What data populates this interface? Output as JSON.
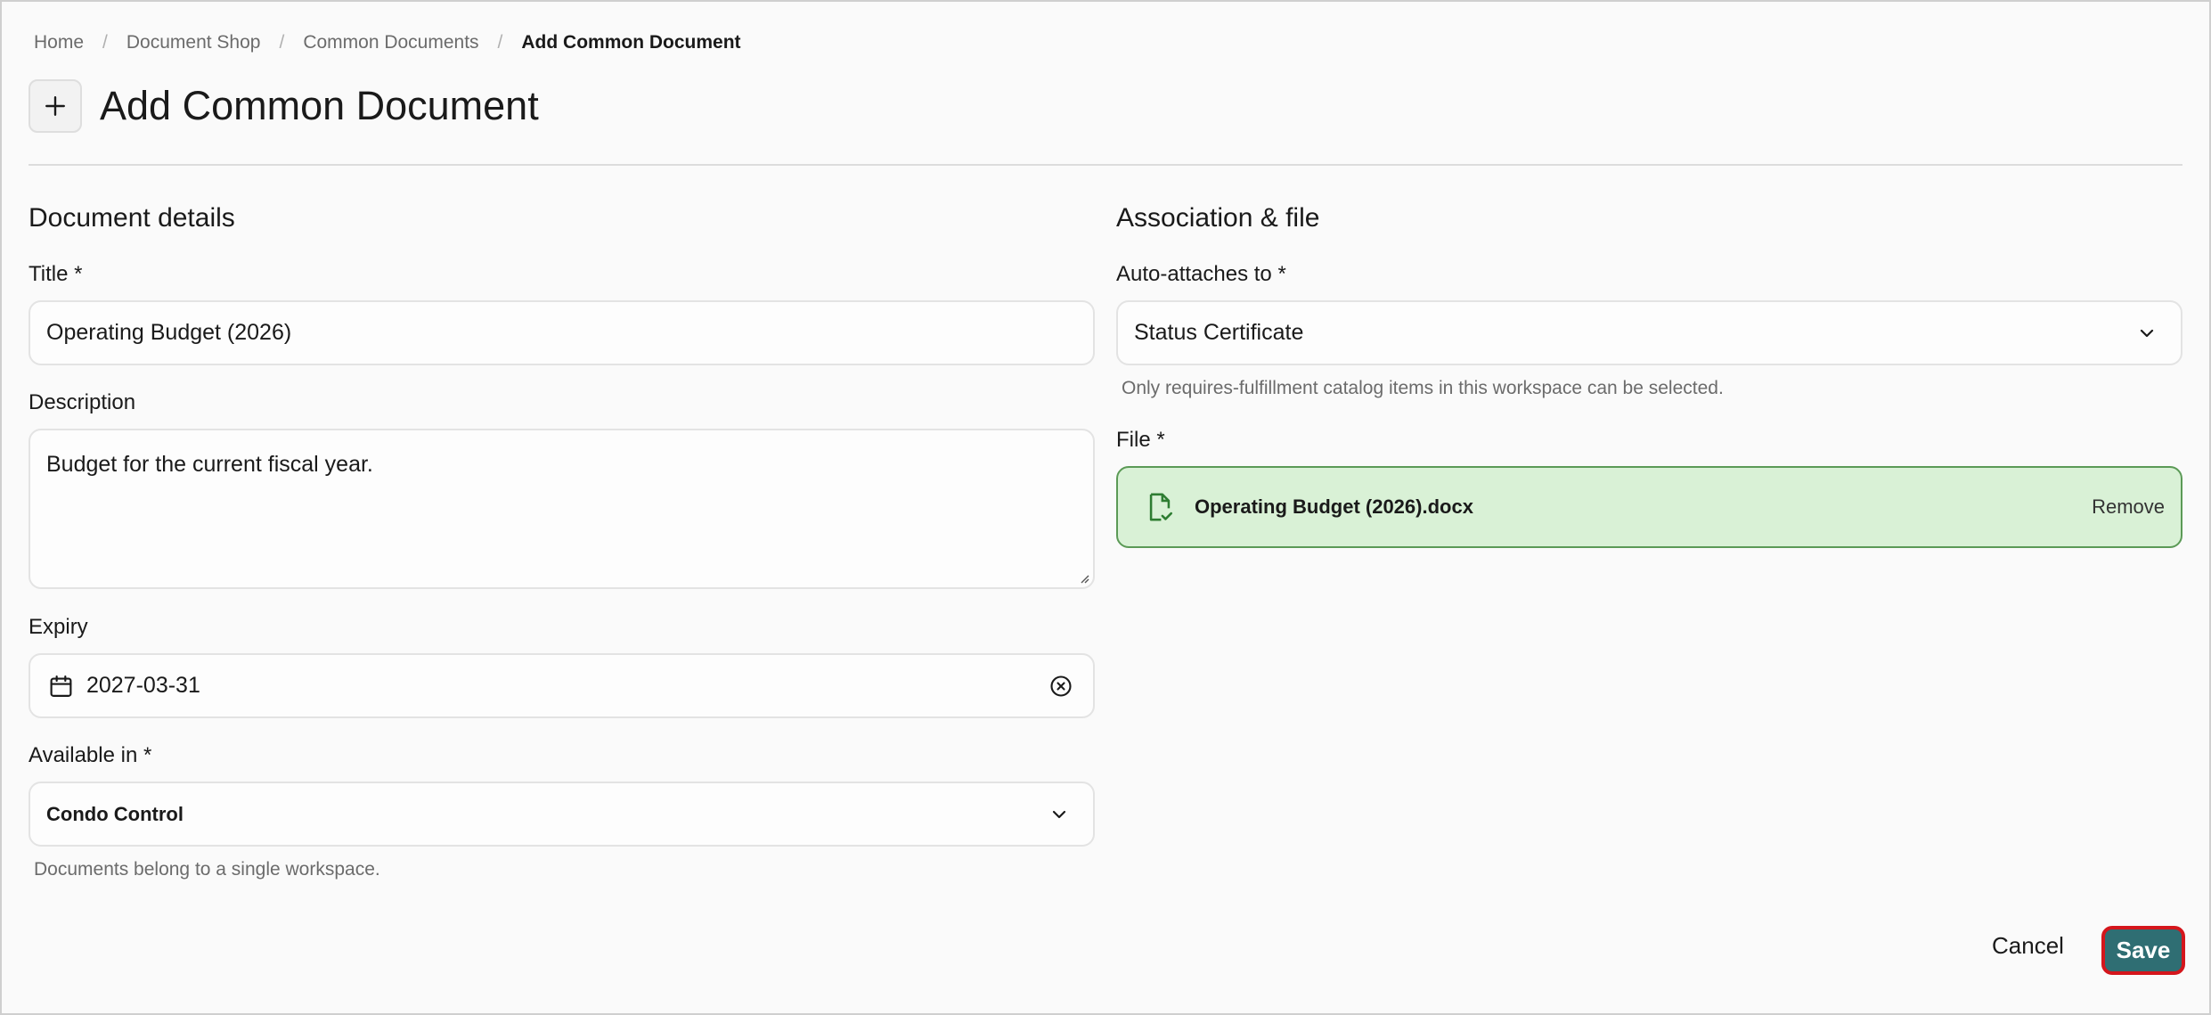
{
  "breadcrumb": {
    "items": [
      "Home",
      "Document Shop",
      "Common Documents"
    ],
    "separator": "/",
    "current": "Add Common Document"
  },
  "header": {
    "title": "Add Common Document",
    "icon": "plus-icon"
  },
  "left": {
    "section_title": "Document details",
    "title_label": "Title *",
    "title_value": "Operating Budget (2026)",
    "description_label": "Description",
    "description_value": "Budget for the current fiscal year.",
    "expiry_label": "Expiry",
    "expiry_value": "2027-03-31",
    "available_label": "Available in *",
    "available_value": "Condo Control",
    "available_helper": "Documents belong to a single workspace."
  },
  "right": {
    "section_title": "Association & file",
    "attach_label": "Auto-attaches to *",
    "attach_value": "Status Certificate",
    "attach_helper": "Only requires-fulfillment catalog items in this workspace can be selected.",
    "file_label": "File *",
    "file_name": "Operating Budget (2026).docx",
    "remove_label": "Remove"
  },
  "actions": {
    "cancel_label": "Cancel",
    "save_label": "Save"
  },
  "colors": {
    "accent": "#2f6e73",
    "file_bg": "#d9f1d6",
    "file_border": "#5b9a56",
    "focus_ring": "#d4161c"
  }
}
